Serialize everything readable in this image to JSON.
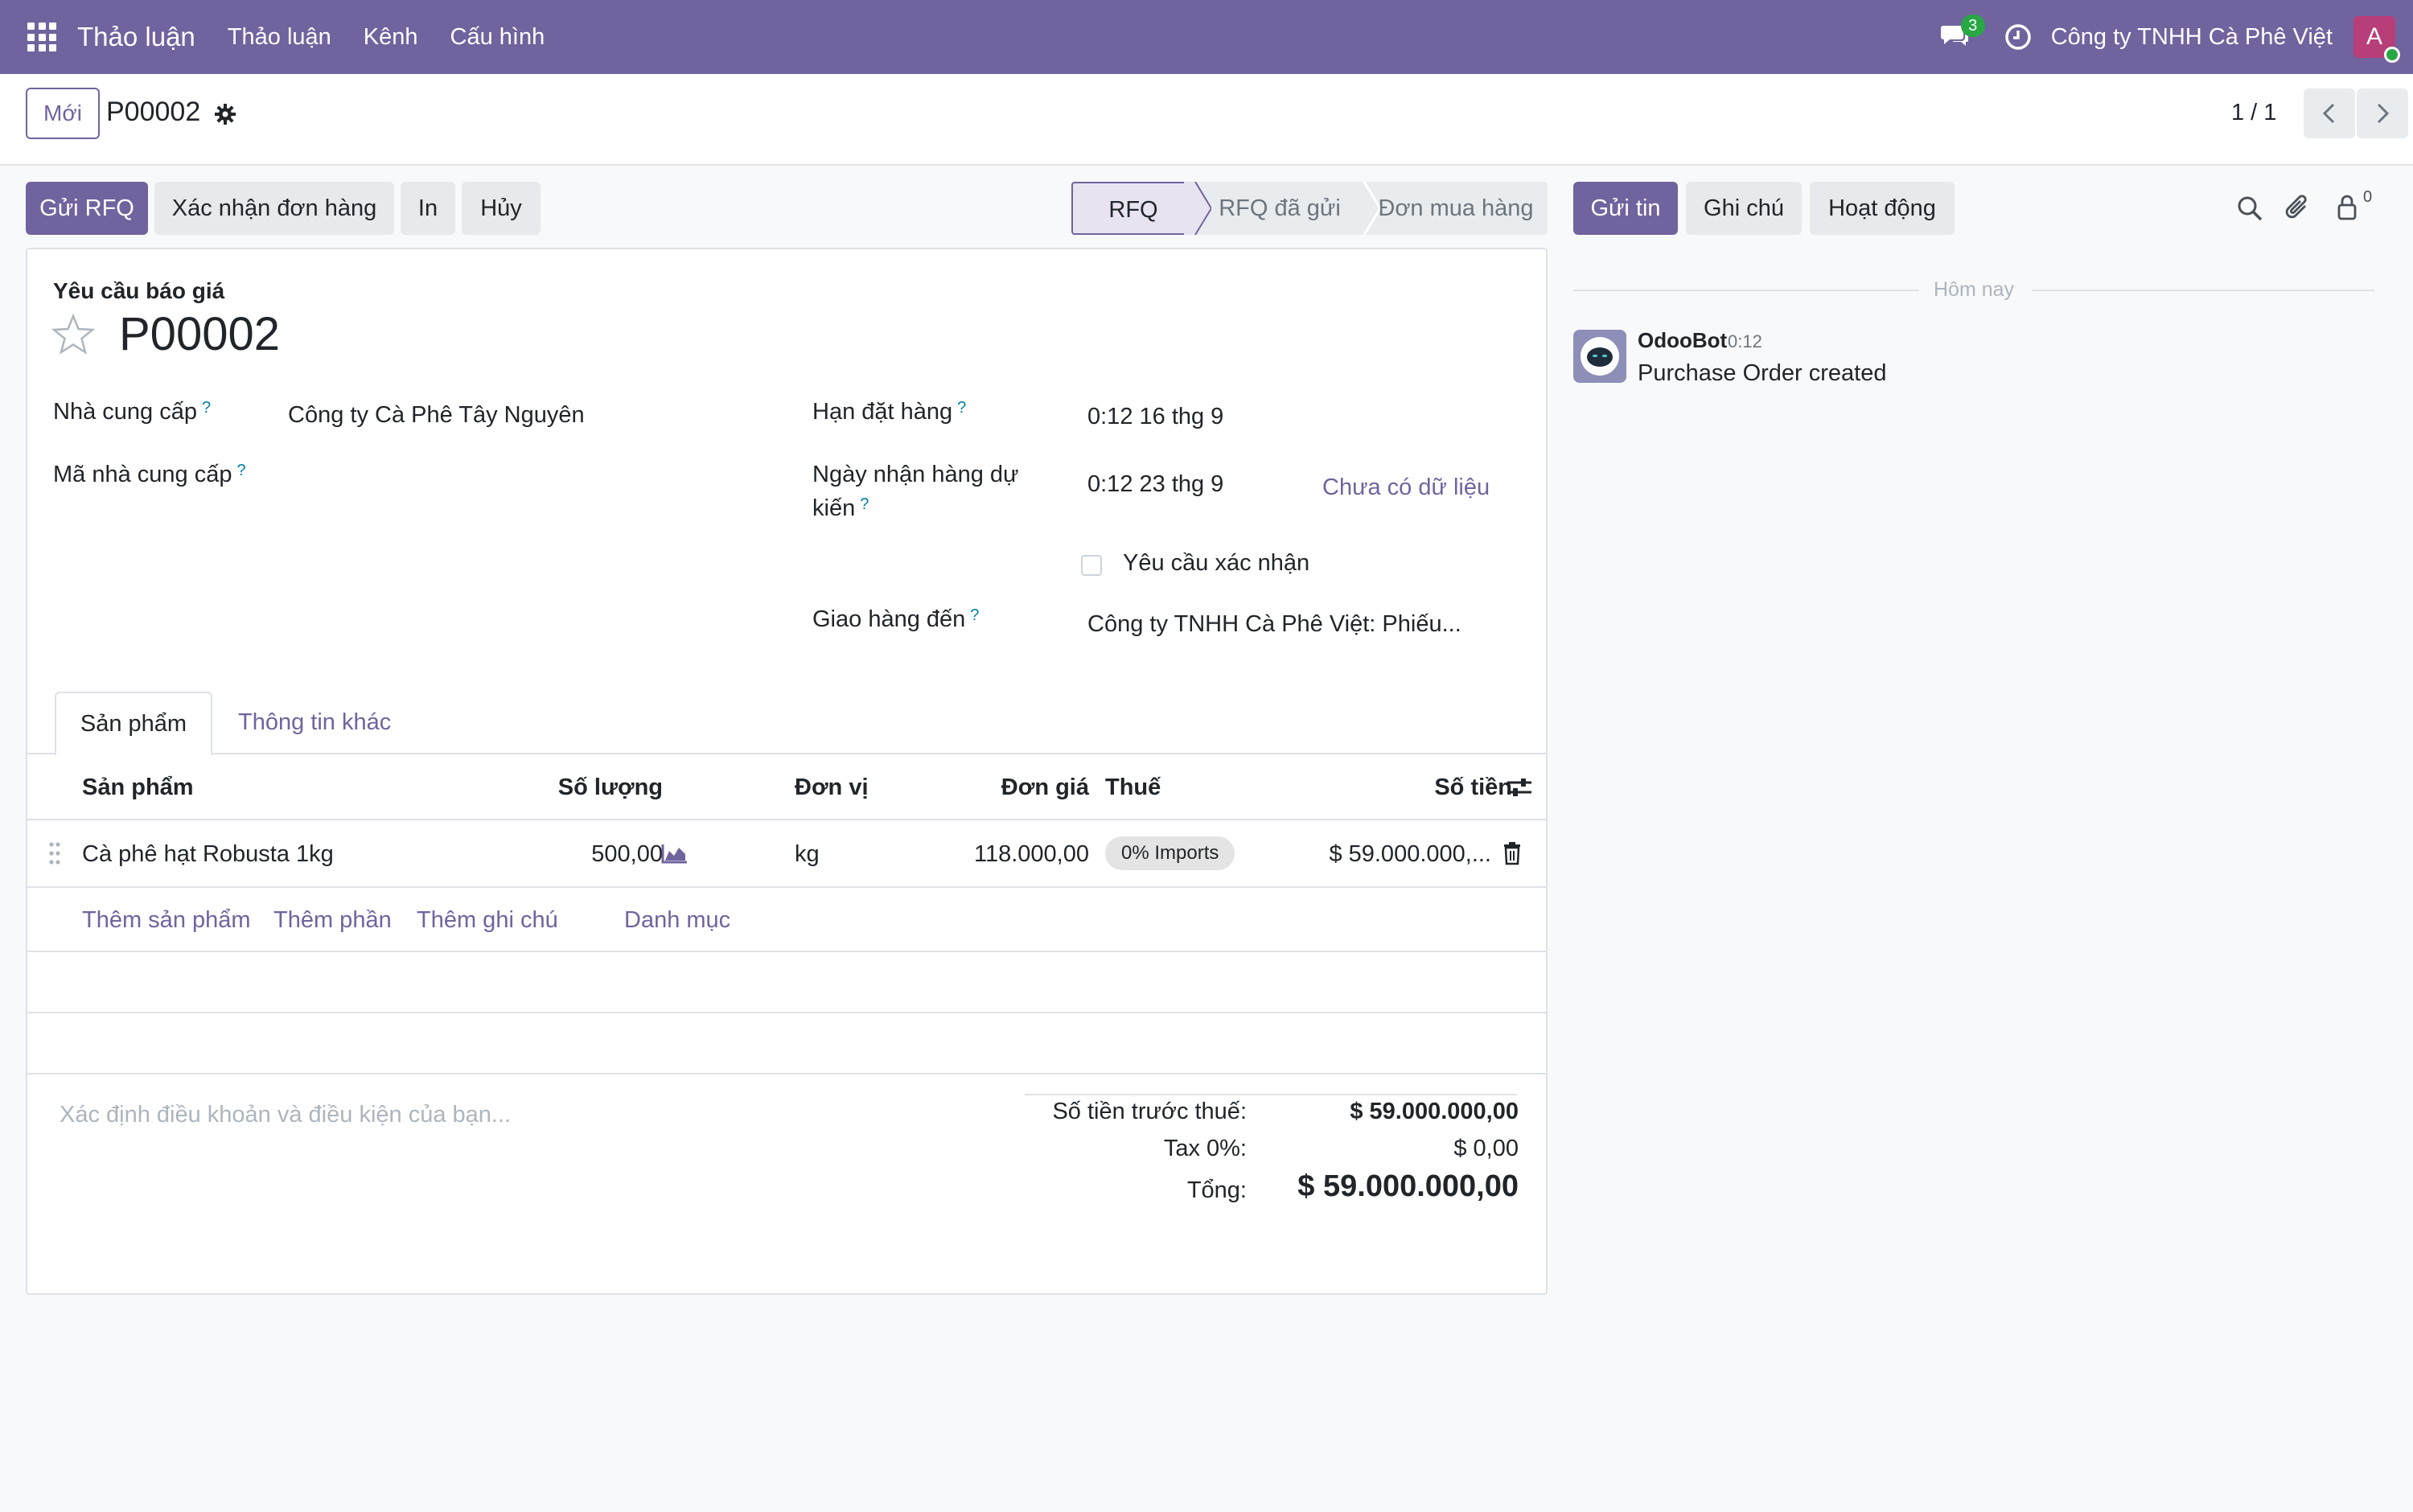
{
  "navbar": {
    "brand": "Thảo luận",
    "menu": [
      "Thảo luận",
      "Kênh",
      "Cấu hình"
    ],
    "chat_badge": "3",
    "company": "Công ty TNHH Cà Phê Việt",
    "avatar_letter": "A"
  },
  "control": {
    "new_label": "Mới",
    "record_name": "P00002",
    "pager": "1 / 1"
  },
  "actions": {
    "send_rfq": "Gửi RFQ",
    "confirm_order": "Xác nhận đơn hàng",
    "print": "In",
    "cancel": "Hủy"
  },
  "status_stages": [
    "RFQ",
    "RFQ đã gửi",
    "Đơn mua hàng"
  ],
  "chatter_buttons": {
    "send_message": "Gửi tin",
    "log_note": "Ghi chú",
    "activity": "Hoạt động",
    "followers_count": "0"
  },
  "form": {
    "subtitle": "Yêu cầu báo giá",
    "title": "P00002",
    "vendor_label": "Nhà cung cấp",
    "vendor_value": "Công ty Cà Phê Tây Nguyên",
    "vendor_ref_label": "Mã nhà cung cấp",
    "order_deadline_label": "Hạn đặt hàng",
    "order_deadline_value": "0:12 16 thg 9",
    "expected_arrival_label_1": "Ngày nhận hàng dự",
    "expected_arrival_label_2": "kiến",
    "expected_arrival_value": "0:12 23 thg 9",
    "no_data_link": "Chưa có dữ liệu",
    "ask_confirmation_label": "Yêu cầu xác nhận",
    "deliver_to_label": "Giao hàng đến",
    "deliver_to_value": "Công ty TNHH Cà Phê Việt: Phiếu...",
    "help_mark": "?"
  },
  "tabs": [
    "Sản phẩm",
    "Thông tin khác"
  ],
  "order_lines": {
    "headers": {
      "product": "Sản phẩm",
      "quantity": "Số lượng",
      "uom": "Đơn vị",
      "price": "Đơn giá",
      "tax": "Thuế",
      "subtotal": "Số tiền"
    },
    "rows": [
      {
        "product": "Cà phê hạt Robusta 1kg",
        "quantity": "500,00",
        "uom": "kg",
        "price": "118.000,00",
        "tax": "0% Imports",
        "subtotal": "$ 59.000.000,..."
      }
    ],
    "add_links": [
      "Thêm sản phẩm",
      "Thêm phần",
      "Thêm ghi chú",
      "Danh mục"
    ]
  },
  "terms_placeholder": "Xác định điều khoản và điều kiện của bạn...",
  "totals": {
    "untaxed_label": "Số tiền trước thuế:",
    "untaxed_value": "$ 59.000.000,00",
    "tax_label": "Tax 0%:",
    "tax_value": "$ 0,00",
    "total_label": "Tổng:",
    "total_value": "$ 59.000.000,00"
  },
  "chatter": {
    "date_separator": "Hôm nay",
    "messages": [
      {
        "author": "OdooBot",
        "time": "0:12",
        "body": "Purchase Order created"
      }
    ]
  },
  "colors": {
    "brand": "#71639e",
    "badge_green": "#28a745",
    "avatar": "#b83e7a",
    "help_blue": "#0180a5"
  }
}
